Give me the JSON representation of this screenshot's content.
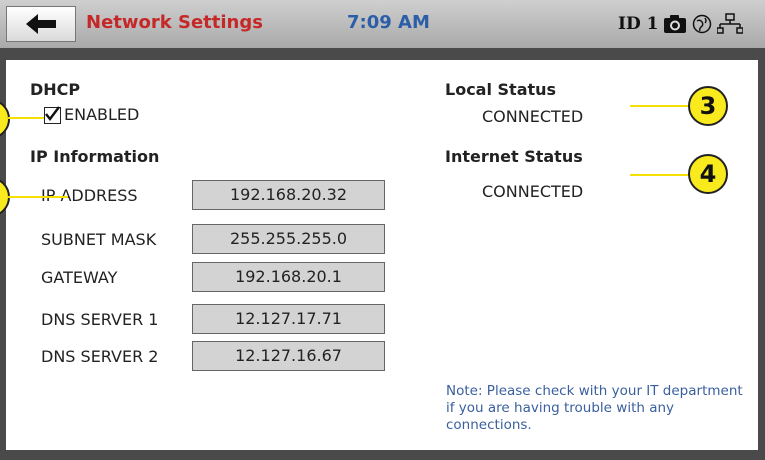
{
  "header": {
    "title": "Network Settings",
    "time": "7:09 AM",
    "id_label": "ID 1",
    "icons": [
      "back-arrow-icon",
      "camera-icon",
      "globe-icon",
      "network-icon"
    ]
  },
  "dhcp": {
    "title": "DHCP",
    "checkbox_label": "ENABLED",
    "checked": true
  },
  "ip_info": {
    "title": "IP Information",
    "rows": [
      {
        "label": "IP ADDRESS",
        "value": "192.168.20.32"
      },
      {
        "label": "SUBNET MASK",
        "value": "255.255.255.0"
      },
      {
        "label": "GATEWAY",
        "value": "192.168.20.1"
      },
      {
        "label": "DNS SERVER 1",
        "value": "12.127.17.71"
      },
      {
        "label": "DNS SERVER 2",
        "value": "12.127.16.67"
      }
    ]
  },
  "status": {
    "local_title": "Local Status",
    "local_value": "CONNECTED",
    "internet_title": "Internet Status",
    "internet_value": "CONNECTED"
  },
  "note": "Note: Please check with your IT department if you are having trouble with any connections.",
  "callouts": [
    "3",
    "4"
  ],
  "colors": {
    "title_red": "#c62828",
    "time_blue": "#2c5ea8",
    "note_blue": "#3a5f9e",
    "callout_yellow": "#f9ea1e",
    "field_gray": "#d3d3d3"
  }
}
